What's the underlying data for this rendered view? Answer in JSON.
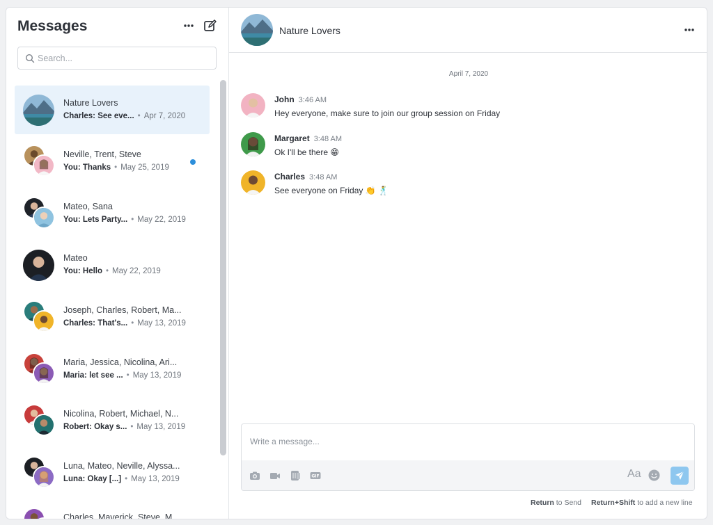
{
  "sidebar": {
    "title": "Messages",
    "more_icon": "more-horizontal-icon",
    "compose_icon": "compose-icon",
    "search_placeholder": "Search...",
    "conversations": [
      {
        "name": "Nature Lovers",
        "snippet": "Charles: See eve...",
        "date": "Apr 7, 2020",
        "active": true
      },
      {
        "name": "Neville, Trent, Steve",
        "snippet": "You: Thanks",
        "date": "May 25, 2019",
        "unread": true
      },
      {
        "name": "Mateo, Sana",
        "snippet": "You: Lets Party...",
        "date": "May 22, 2019"
      },
      {
        "name": "Mateo",
        "snippet": "You: Hello",
        "date": "May 22, 2019"
      },
      {
        "name": "Joseph, Charles, Robert, Ma...",
        "snippet": "Charles: That's...",
        "date": "May 13, 2019"
      },
      {
        "name": "Maria, Jessica, Nicolina, Ari...",
        "snippet": "Maria: let see ...",
        "date": "May 13, 2019"
      },
      {
        "name": "Nicolina, Robert, Michael, N...",
        "snippet": "Robert: Okay s...",
        "date": "May 13, 2019"
      },
      {
        "name": "Luna, Mateo, Neville, Alyssa...",
        "snippet": "Luna: Okay [...]",
        "date": "May 13, 2019"
      },
      {
        "name": "Charles, Maverick, Steve, M...",
        "snippet": "",
        "date": ""
      }
    ],
    "separator": "•"
  },
  "chat": {
    "title": "Nature Lovers",
    "date_divider": "April 7, 2020",
    "messages": [
      {
        "author": "John",
        "time": "3:46 AM",
        "text": "Hey everyone, make sure to join our group session on Friday"
      },
      {
        "author": "Margaret",
        "time": "3:48 AM",
        "text": "Ok I'll be there 😁"
      },
      {
        "author": "Charles",
        "time": "3:48 AM",
        "text": "See everyone on Friday 👏 🕺"
      }
    ],
    "composer_placeholder": "Write a message...",
    "toolbar_icons": [
      "camera-icon",
      "video-icon",
      "sticker-icon",
      "gif-icon"
    ],
    "font_toggle": "Aa",
    "send_icon": "send-icon",
    "hint_return_key": "Return",
    "hint_return_text": "to Send",
    "hint_shift_key": "Return+Shift",
    "hint_shift_text": "to add a new line"
  },
  "colors": {
    "accent": "#2d8fdb",
    "active_row": "#e8f2fb",
    "send_button": "#8ec7ef"
  }
}
